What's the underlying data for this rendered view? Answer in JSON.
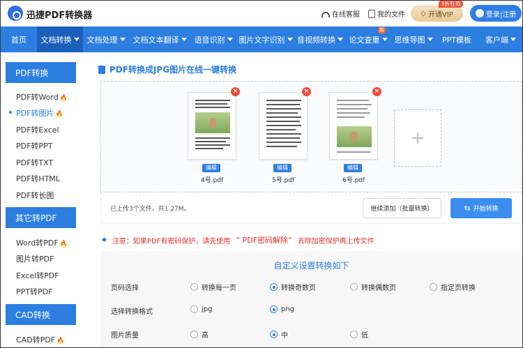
{
  "app": {
    "name": "迅捷PDF转换器",
    "logo_icon": "logo-icon"
  },
  "header": {
    "support": "在线客服",
    "my_files": "我的文件",
    "vip_label": "开通VIP",
    "vip_badge": "3折狂欢",
    "login": "登录|注册"
  },
  "nav": {
    "items": [
      {
        "label": "首页",
        "dropdown": false,
        "active": false
      },
      {
        "label": "文档转换",
        "dropdown": true,
        "active": true
      },
      {
        "label": "文档处理",
        "dropdown": true,
        "active": false
      },
      {
        "label": "文档文本翻译",
        "dropdown": true,
        "active": false
      },
      {
        "label": "语音识别",
        "dropdown": true,
        "active": false
      },
      {
        "label": "图片文字识别",
        "dropdown": true,
        "active": false
      },
      {
        "label": "音视频转换",
        "dropdown": true,
        "active": false
      },
      {
        "label": "论文查重",
        "dropdown": true,
        "active": false,
        "badge": "新"
      },
      {
        "label": "思维导图",
        "dropdown": true,
        "active": false
      },
      {
        "label": "PPT模板",
        "dropdown": false,
        "active": false
      },
      {
        "label": "客户端",
        "dropdown": true,
        "active": false
      }
    ]
  },
  "sidebar": {
    "groups": [
      {
        "title": "PDF转换",
        "items": [
          {
            "label": "PDF转Word",
            "hot": true,
            "active": false
          },
          {
            "label": "PDF转图片",
            "hot": true,
            "active": true
          },
          {
            "label": "PDF转Excel",
            "hot": false,
            "active": false
          },
          {
            "label": "PDF转PPT",
            "hot": false,
            "active": false
          },
          {
            "label": "PDF转TXT",
            "hot": false,
            "active": false
          },
          {
            "label": "PDF转HTML",
            "hot": false,
            "active": false
          },
          {
            "label": "PDF转长图",
            "hot": false,
            "active": false
          }
        ]
      },
      {
        "title": "其它转PDF",
        "items": [
          {
            "label": "Word转PDF",
            "hot": true,
            "active": false
          },
          {
            "label": "图片转PDF",
            "hot": false,
            "active": false
          },
          {
            "label": "Excel转PDF",
            "hot": false,
            "active": false
          },
          {
            "label": "PPT转PDF",
            "hot": false,
            "active": false
          }
        ]
      },
      {
        "title": "CAD转换",
        "items": [
          {
            "label": "CAD转PDF",
            "hot": true,
            "active": false
          }
        ]
      }
    ]
  },
  "main": {
    "title": "PDF转换成JPG图片在线一键转换",
    "files": [
      {
        "name": "4号.pdf",
        "edit": "编辑"
      },
      {
        "name": "5号.pdf",
        "edit": "编辑"
      },
      {
        "name": "6号.pdf",
        "edit": "编辑"
      }
    ],
    "add_icon": "+",
    "status": "已上传3个文件，共1.27M。",
    "continue_btn": "继续添加（批量转换）",
    "start_btn": "开始转换",
    "notice_prefix": "注意：如果PDF有密码保护，请先使用",
    "notice_link": "“ PDF密码解除”",
    "notice_suffix": "去除加密保护再上传文件"
  },
  "settings": {
    "title": "自定义设置转换如下",
    "rows": [
      {
        "label": "页码选择",
        "options": [
          "转换每一页",
          "转换奇数页",
          "转换偶数页",
          "指定页转换"
        ],
        "selected": 1
      },
      {
        "label": "选择转换格式",
        "options": [
          "jpg",
          "png"
        ],
        "selected": 1
      },
      {
        "label": "图片质量",
        "options": [
          "高",
          "中",
          "低"
        ],
        "selected": 1
      }
    ]
  },
  "colors": {
    "primary": "#2c7ee0",
    "nav_active": "#1a5fba",
    "warning": "#e0312a",
    "hot": "#ff6a2b"
  }
}
